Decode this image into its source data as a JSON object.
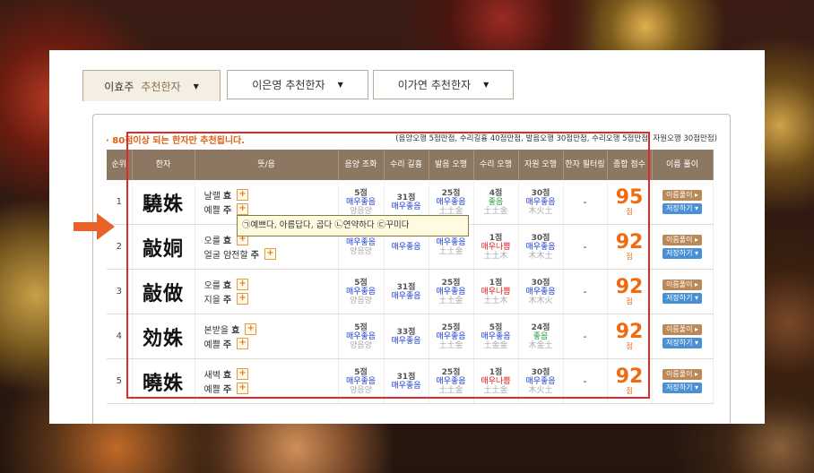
{
  "tabs": [
    {
      "name": "이효주",
      "suffix": "추천한자",
      "active": true
    },
    {
      "name": "이은영",
      "suffix": "추천한자",
      "active": false
    },
    {
      "name": "이가연",
      "suffix": "추천한자",
      "active": false
    }
  ],
  "notice": "· 80점이상 되는 한자만 추천됩니다.",
  "legend": "(음양오행 5점만점, 수리길흉 40점만점, 발음오행 30점만점, 수리오행 5점만점, 자원오행 30점만점)",
  "columns": [
    "순위",
    "한자",
    "뜻/음",
    "음양 조화",
    "수리 길흉",
    "발음 오행",
    "수리 오행",
    "자원 오행",
    "한자 필터링",
    "종합 점수",
    "이름 풀이"
  ],
  "rows": [
    {
      "rank": "1",
      "hanja": "驍姝",
      "m1": "날랠",
      "r1": "효",
      "m2": "예쁠",
      "r2": "주",
      "yy": [
        "5점",
        "매우좋음",
        "양음양"
      ],
      "sg": [
        "31점",
        "매우좋음",
        ""
      ],
      "bo": [
        "25점",
        "매우좋음",
        "土土金"
      ],
      "so": [
        "4점",
        "좋음",
        "土土金"
      ],
      "jo": [
        "30점",
        "매우좋음",
        "木火土"
      ],
      "filter": "-",
      "total": "95"
    },
    {
      "rank": "2",
      "hanja": "敲姛",
      "m1": "오를",
      "r1": "효",
      "m2": "얼굴 얌전할",
      "r2": "주",
      "yy": [
        "",
        "매우좋음",
        "양음양"
      ],
      "sg": [
        "",
        "매우좋음",
        ""
      ],
      "bo": [
        "",
        "매우좋음",
        "土土金"
      ],
      "so": [
        "1점",
        "매우나쁨",
        "土土木"
      ],
      "jo": [
        "30점",
        "매우좋음",
        "木木土"
      ],
      "filter": "-",
      "total": "92"
    },
    {
      "rank": "3",
      "hanja": "敲做",
      "m1": "오를",
      "r1": "효",
      "m2": "지을",
      "r2": "주",
      "yy": [
        "5점",
        "매우좋음",
        "양음양"
      ],
      "sg": [
        "31점",
        "매우좋음",
        ""
      ],
      "bo": [
        "25점",
        "매우좋음",
        "土土金"
      ],
      "so": [
        "1점",
        "매우나쁨",
        "土土木"
      ],
      "jo": [
        "30점",
        "매우좋음",
        "木木火"
      ],
      "filter": "-",
      "total": "92"
    },
    {
      "rank": "4",
      "hanja": "効姝",
      "m1": "본받을",
      "r1": "효",
      "m2": "예쁠",
      "r2": "주",
      "yy": [
        "5점",
        "매우좋음",
        "양음양"
      ],
      "sg": [
        "33점",
        "매우좋음",
        ""
      ],
      "bo": [
        "25점",
        "매우좋음",
        "土土金"
      ],
      "so": [
        "5점",
        "매우좋음",
        "土金金"
      ],
      "jo": [
        "24점",
        "좋음",
        "木金土"
      ],
      "filter": "-",
      "total": "92"
    },
    {
      "rank": "5",
      "hanja": "曉姝",
      "m1": "새벽",
      "r1": "효",
      "m2": "예쁠",
      "r2": "주",
      "yy": [
        "5점",
        "매우좋음",
        "양음양"
      ],
      "sg": [
        "31점",
        "매우좋음",
        ""
      ],
      "bo": [
        "25점",
        "매우좋음",
        "土土金"
      ],
      "so": [
        "1점",
        "매우나쁨",
        "土土金"
      ],
      "jo": [
        "30점",
        "매우좋음",
        "木火土"
      ],
      "filter": "-",
      "total": "92"
    }
  ],
  "total_unit": "점",
  "btn_reading": "이름풀이 ▸",
  "btn_save": "저장하기 ▾",
  "tooltip": "㉠예쁘다, 아름답다, 곱다 ㉡연약하다 ㉢꾸미다",
  "colors": {
    "header": "#8c7762",
    "accent": "#f06a10",
    "highlight_box": "#e02a2a",
    "good": "#1a3bd0",
    "bad": "#e01818"
  }
}
